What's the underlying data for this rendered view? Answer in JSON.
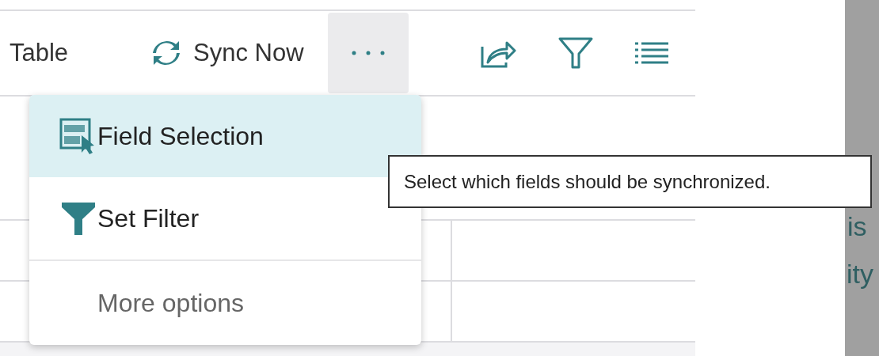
{
  "toolbar": {
    "actions": [
      {
        "kind": "text",
        "label": "Table"
      },
      {
        "kind": "sync",
        "label": "Sync Now"
      },
      {
        "kind": "more",
        "expanded": true
      }
    ],
    "icons": [
      {
        "kind": "share"
      },
      {
        "kind": "filter"
      },
      {
        "kind": "list"
      }
    ]
  },
  "menu": {
    "items": [
      {
        "kind": "field",
        "label": "Field Selection",
        "selected": true
      },
      {
        "kind": "filter",
        "label": "Set Filter",
        "selected": false
      },
      {
        "kind": "secondary",
        "label": "More options",
        "selected": false
      }
    ]
  },
  "tooltip": {
    "text": "Select which fields should be synchronized."
  },
  "side_panel": {
    "texts": [
      "is",
      "ity"
    ]
  }
}
